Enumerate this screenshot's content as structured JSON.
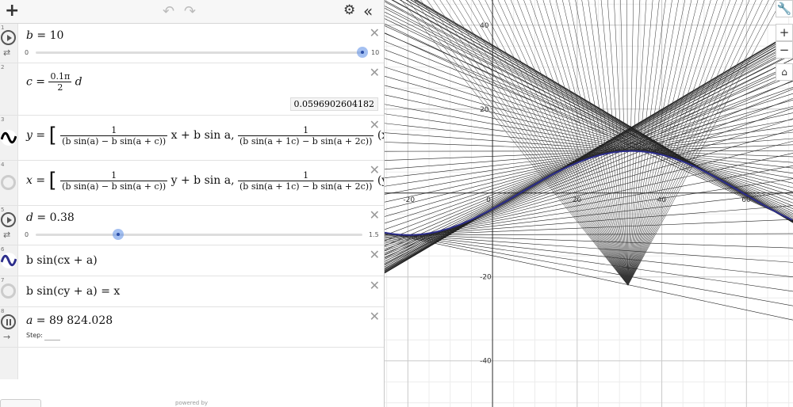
{
  "toolbar": {
    "add_icon": "plus-icon",
    "undo_icon": "undo-icon",
    "redo_icon": "redo-icon",
    "settings_icon": "gear-icon",
    "collapse_icon": "double-chevron-left-icon"
  },
  "expressions": [
    {
      "num": "1",
      "text_lhs": "b",
      "text_rhs": "10",
      "slider_min": "0",
      "slider_max": "10",
      "slider_fraction": 1.0
    },
    {
      "num": "2",
      "text": "c =",
      "frac_num": "0.1π",
      "frac_den": "2",
      "tail": "d",
      "eq_sign": "=",
      "value": "0.0596902604182"
    },
    {
      "num": "3",
      "lhs": "y",
      "f1_num": "1",
      "f1_den": "(b sin(a) − b sin(a + c))",
      "mid": "x + b sin a,",
      "f2_num": "1",
      "f2_den": "(b sin(a + 1c) − b sin(a + 2c))",
      "tail": "(x −"
    },
    {
      "num": "4",
      "lhs": "x",
      "f1_num": "1",
      "f1_den": "(b sin(a) − b sin(a + c))",
      "mid": "y + b sin a,",
      "f2_num": "1",
      "f2_den": "(b sin(a + 1c) − b sin(a + 2c))",
      "tail": "(y −"
    },
    {
      "num": "5",
      "text_lhs": "d",
      "text_rhs": "0.38",
      "slider_min": "0",
      "slider_max": "1.5",
      "slider_fraction": 0.2533
    },
    {
      "num": "6",
      "text": "b sin(cx + a)",
      "color": "#2d2e8c"
    },
    {
      "num": "7",
      "text": "b sin(cy + a) = x"
    },
    {
      "num": "8",
      "text_lhs": "a",
      "text_rhs": "89 824.028",
      "step_label": "Step:"
    }
  ],
  "footer": {
    "powered_by": "powered by"
  },
  "graph": {
    "x_ticks": [
      "-20",
      "0",
      "20",
      "40",
      "60"
    ],
    "y_ticks": [
      "40",
      "20",
      "-20",
      "-40"
    ],
    "x_range": [
      -25.5,
      71
    ],
    "y_range": [
      -51,
      46
    ],
    "curve_color": "#2d2e8c",
    "zoom": {
      "wrench_icon": "wrench-icon",
      "zoom_in": "+",
      "zoom_out": "−",
      "home_icon": "home-icon"
    }
  },
  "chart_data": {
    "type": "line",
    "series": [
      {
        "name": "b sin(cx + a)",
        "b": 10,
        "c": 0.0596902604182,
        "a": 89824.028
      }
    ],
    "xlim": [
      -25.5,
      71
    ],
    "ylim": [
      -51,
      46
    ],
    "grid": true
  }
}
